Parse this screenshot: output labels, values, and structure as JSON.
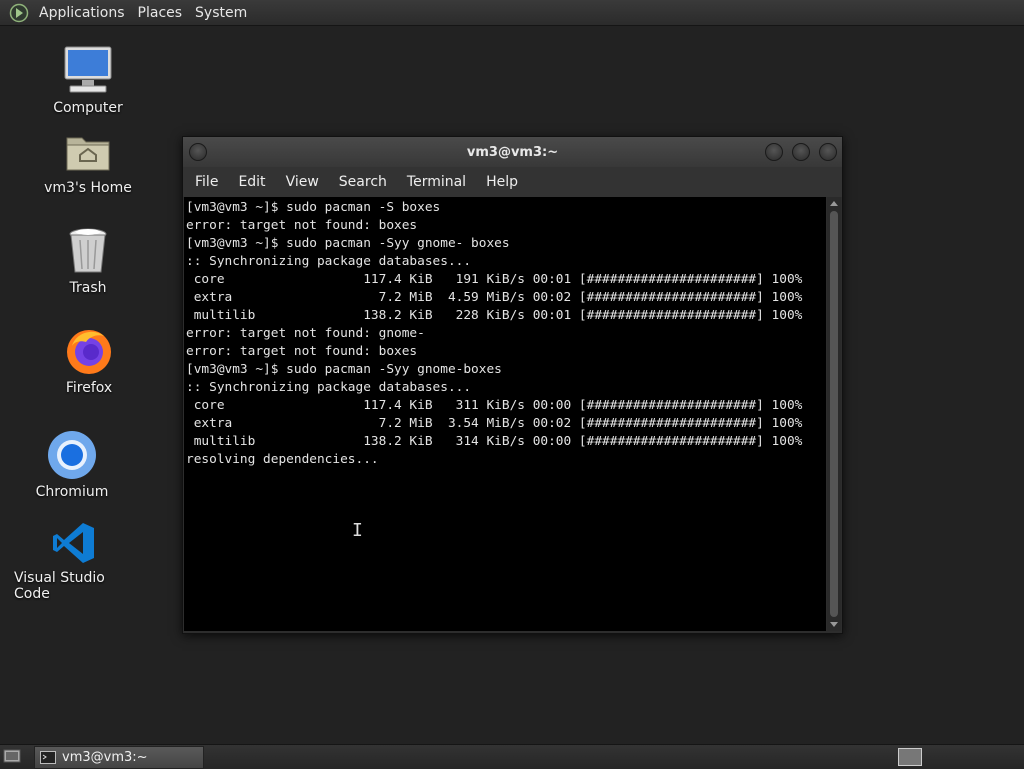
{
  "top_panel": {
    "menus": [
      "Applications",
      "Places",
      "System"
    ]
  },
  "desktop_icons": [
    {
      "label": "Computer",
      "icon": "computer-icon"
    },
    {
      "label": "vm3's Home",
      "icon": "home-folder-icon"
    },
    {
      "label": "Trash",
      "icon": "trash-icon"
    },
    {
      "label": "Firefox",
      "icon": "firefox-icon"
    },
    {
      "label": "Chromium",
      "icon": "chromium-icon"
    },
    {
      "label": "Visual Studio Code",
      "icon": "vscode-icon"
    }
  ],
  "window": {
    "title": "vm3@vm3:~",
    "menus": [
      "File",
      "Edit",
      "View",
      "Search",
      "Terminal",
      "Help"
    ],
    "terminal_lines": [
      "[vm3@vm3 ~]$ sudo pacman -S boxes",
      "error: target not found: boxes",
      "[vm3@vm3 ~]$ sudo pacman -Syy gnome- boxes",
      ":: Synchronizing package databases...",
      " core                  117.4 KiB   191 KiB/s 00:01 [######################] 100%",
      " extra                   7.2 MiB  4.59 MiB/s 00:02 [######################] 100%",
      " multilib              138.2 KiB   228 KiB/s 00:01 [######################] 100%",
      "error: target not found: gnome-",
      "error: target not found: boxes",
      "[vm3@vm3 ~]$ sudo pacman -Syy gnome-boxes",
      ":: Synchronizing package databases...",
      " core                  117.4 KiB   311 KiB/s 00:00 [######################] 100%",
      " extra                   7.2 MiB  3.54 MiB/s 00:02 [######################] 100%",
      " multilib              138.2 KiB   314 KiB/s 00:00 [######################] 100%",
      "resolving dependencies..."
    ]
  },
  "taskbar": {
    "task_label": "vm3@vm3:~"
  }
}
